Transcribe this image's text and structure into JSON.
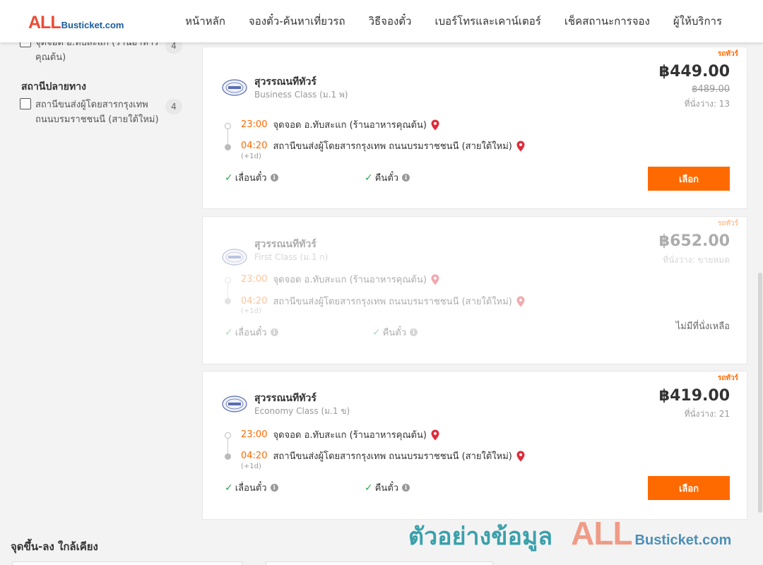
{
  "header": {
    "logo_all": "ALL",
    "logo_rest": "Busticket.com",
    "nav": [
      "หน้าหลัก",
      "จองตั๋ว-ค้นหาเที่ยวรถ",
      "วิธีจองตั๋ว",
      "เบอร์โทรและเคาน์เตอร์",
      "เช็คสถานะการจอง",
      "ผู้ให้บริการ"
    ]
  },
  "sidebar": {
    "boarding_filter": {
      "label": "จุดจอด อ.ทับสะแก (ร้านอาหารคุณต้น)",
      "count": "4"
    },
    "destination_heading": "สถานีปลายทาง",
    "destination_filter": {
      "label": "สถานีขนส่งผู้โดยสารกรุงเทพ ถนนบรมราชชนนี (สายใต้ใหม่)",
      "count": "4"
    }
  },
  "trips": [
    {
      "tag": "รถทัวร์",
      "operator": "สุวรรณนทีทัวร์",
      "bus_class": "Business Class (ม.1 พ)",
      "price": "฿449.00",
      "old_price": "฿489.00",
      "seats": "ที่นั่งว่าง: 13",
      "depart_time": "23:00",
      "depart_place": "จุดจอด อ.ทับสะแก (ร้านอาหารคุณต้น)",
      "arrive_time": "04:20",
      "arrive_place": "สถานีขนส่งผู้โดยสารกรุงเทพ ถนนบรมราชชนนี (สายใต้ใหม่)",
      "next_day": "(+1d)",
      "feature_1": "เลื่อนตั๋ว",
      "feature_2": "คืนตั๋ว",
      "button": "เลือก"
    },
    {
      "tag": "รถทัวร์",
      "operator": "สุวรรณนทีทัวร์",
      "bus_class": "First Class (ม.1 ก)",
      "price": "฿652.00",
      "seats": "ที่นั่งว่าง: ขายหมด",
      "depart_time": "23:00",
      "depart_place": "จุดจอด อ.ทับสะแก (ร้านอาหารคุณต้น)",
      "arrive_time": "04:20",
      "arrive_place": "สถานีขนส่งผู้โดยสารกรุงเทพ ถนนบรมราชชนนี (สายใต้ใหม่)",
      "next_day": "(+1d)",
      "feature_1": "เลื่อนตั๋ว",
      "feature_2": "คืนตั๋ว",
      "status": "ไม่มีที่นั่งเหลือ"
    },
    {
      "tag": "รถทัวร์",
      "operator": "สุวรรณนทีทัวร์",
      "bus_class": "Economy Class (ม.1 ข)",
      "price": "฿419.00",
      "seats": "ที่นั่งว่าง: 21",
      "depart_time": "23:00",
      "depart_place": "จุดจอด อ.ทับสะแก (ร้านอาหารคุณต้น)",
      "arrive_time": "04:20",
      "arrive_place": "สถานีขนส่งผู้โดยสารกรุงเทพ ถนนบรมราชชนนี (สายใต้ใหม่)",
      "next_day": "(+1d)",
      "feature_1": "เลื่อนตั๋ว",
      "feature_2": "คืนตั๋ว",
      "button": "เลือก"
    }
  ],
  "nearby_heading": "จุดขึ้น-ลง ใกล้เคียง",
  "watermark": {
    "text": "ตัวอย่างข้อมูล",
    "all": "ALL",
    "rest": "Busticket.com"
  },
  "colors": {
    "accent": "#ff6a00",
    "brand_red": "#ec4c37",
    "brand_blue": "#1a5da0",
    "check_green": "#2fa84f",
    "pin_red": "#e02b3a"
  },
  "icons": {
    "pin": "map-pin-icon",
    "check": "check-icon",
    "info": "info-icon",
    "operator_logo": "operator-logo-icon"
  }
}
